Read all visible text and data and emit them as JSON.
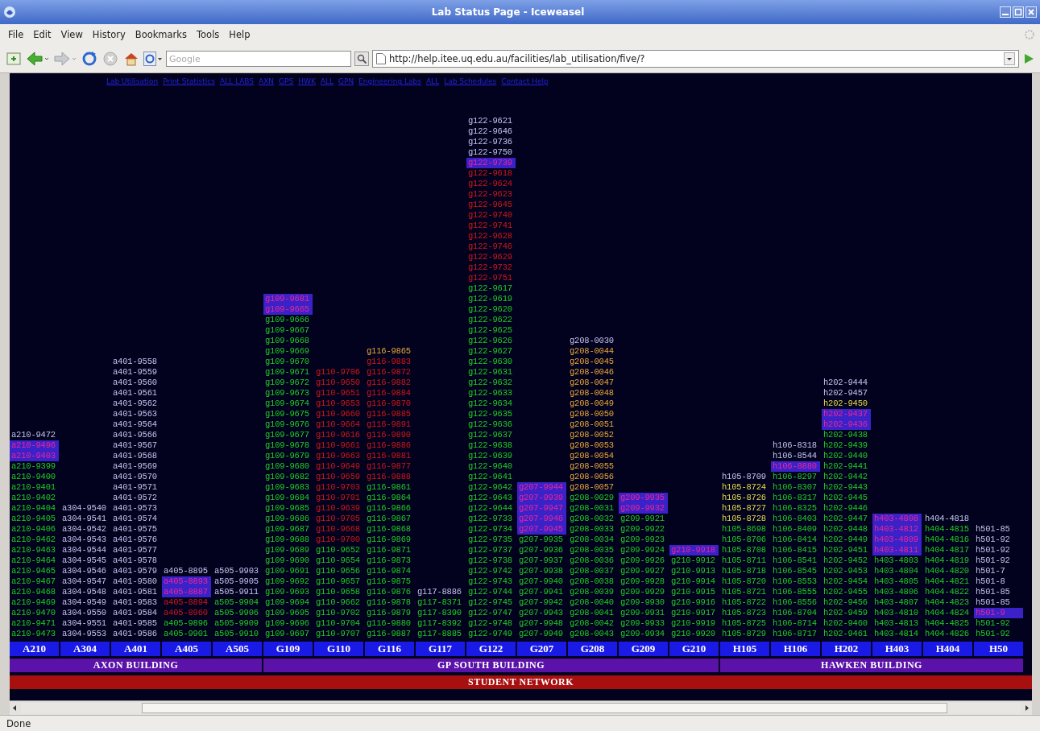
{
  "window": {
    "title": "Lab Status Page - Iceweasel"
  },
  "menu": [
    "File",
    "Edit",
    "View",
    "History",
    "Bookmarks",
    "Tools",
    "Help"
  ],
  "toolbar": {
    "search": {
      "placeholder": "Google"
    },
    "address": "http://help.itee.uq.edu.au/facilities/lab_utilisation/five/?"
  },
  "nav_links": [
    "Lab Utilisation",
    "Print Statistics",
    "ALL LABS",
    "AXN",
    "GPS",
    "HWK",
    "ALL",
    "GPN",
    "Engineering Labs",
    "ALL",
    "Lab Schedules",
    "Contact Help"
  ],
  "buildings": [
    {
      "label": "AXON BUILDING",
      "rooms": [
        {
          "label": "A210",
          "hosts": [
            {
              "name": "a210-9472",
              "kind": "free"
            },
            {
              "name": "a210-9496",
              "kind": "locked"
            },
            {
              "name": "a210-9403",
              "kind": "locked"
            },
            {
              "name": "a210-9399",
              "kind": "used"
            },
            {
              "name": "a210-9400",
              "kind": "used"
            },
            {
              "name": "a210-9401",
              "kind": "used"
            },
            {
              "name": "a210-9402",
              "kind": "used"
            },
            {
              "name": "a210-9404",
              "kind": "used"
            },
            {
              "name": "a210-9405",
              "kind": "used"
            },
            {
              "name": "a210-9406",
              "kind": "used"
            },
            {
              "name": "a210-9462",
              "kind": "used"
            },
            {
              "name": "a210-9463",
              "kind": "used"
            },
            {
              "name": "a210-9464",
              "kind": "used"
            },
            {
              "name": "a210-9465",
              "kind": "used"
            },
            {
              "name": "a210-9467",
              "kind": "used"
            },
            {
              "name": "a210-9468",
              "kind": "used"
            },
            {
              "name": "a210-9469",
              "kind": "used"
            },
            {
              "name": "a210-9470",
              "kind": "used"
            },
            {
              "name": "a210-9471",
              "kind": "used"
            },
            {
              "name": "a210-9473",
              "kind": "used"
            }
          ]
        },
        {
          "label": "A304",
          "hosts": [
            {
              "name": "a304-9540",
              "kind": "free"
            },
            {
              "name": "a304-9541",
              "kind": "free"
            },
            {
              "name": "a304-9542",
              "kind": "free"
            },
            {
              "name": "a304-9543",
              "kind": "free"
            },
            {
              "name": "a304-9544",
              "kind": "free"
            },
            {
              "name": "a304-9545",
              "kind": "free"
            },
            {
              "name": "a304-9546",
              "kind": "free"
            },
            {
              "name": "a304-9547",
              "kind": "free"
            },
            {
              "name": "a304-9548",
              "kind": "free"
            },
            {
              "name": "a304-9549",
              "kind": "free"
            },
            {
              "name": "a304-9550",
              "kind": "free"
            },
            {
              "name": "a304-9551",
              "kind": "free"
            },
            {
              "name": "a304-9553",
              "kind": "free"
            }
          ]
        },
        {
          "label": "A401",
          "hosts": [
            {
              "name": "a401-9558",
              "kind": "free"
            },
            {
              "name": "a401-9559",
              "kind": "free"
            },
            {
              "name": "a401-9560",
              "kind": "free"
            },
            {
              "name": "a401-9561",
              "kind": "free"
            },
            {
              "name": "a401-9562",
              "kind": "free"
            },
            {
              "name": "a401-9563",
              "kind": "free"
            },
            {
              "name": "a401-9564",
              "kind": "free"
            },
            {
              "name": "a401-9566",
              "kind": "free"
            },
            {
              "name": "a401-9567",
              "kind": "free"
            },
            {
              "name": "a401-9568",
              "kind": "free"
            },
            {
              "name": "a401-9569",
              "kind": "free"
            },
            {
              "name": "a401-9570",
              "kind": "free"
            },
            {
              "name": "a401-9571",
              "kind": "free"
            },
            {
              "name": "a401-9572",
              "kind": "free"
            },
            {
              "name": "a401-9573",
              "kind": "free"
            },
            {
              "name": "a401-9574",
              "kind": "free"
            },
            {
              "name": "a401-9575",
              "kind": "free"
            },
            {
              "name": "a401-9576",
              "kind": "free"
            },
            {
              "name": "a401-9577",
              "kind": "free"
            },
            {
              "name": "a401-9578",
              "kind": "free"
            },
            {
              "name": "a401-9579",
              "kind": "free"
            },
            {
              "name": "a401-9580",
              "kind": "free"
            },
            {
              "name": "a401-9581",
              "kind": "free"
            },
            {
              "name": "a401-9583",
              "kind": "free"
            },
            {
              "name": "a401-9584",
              "kind": "free"
            },
            {
              "name": "a401-9585",
              "kind": "free"
            },
            {
              "name": "a401-9586",
              "kind": "free"
            }
          ]
        },
        {
          "label": "A405",
          "hosts": [
            {
              "name": "a405-8895",
              "kind": "free"
            },
            {
              "name": "a405-8893",
              "kind": "locked"
            },
            {
              "name": "a405-8887",
              "kind": "locked"
            },
            {
              "name": "a405-8894",
              "kind": "down"
            },
            {
              "name": "a405-8960",
              "kind": "down"
            },
            {
              "name": "a405-9896",
              "kind": "used"
            },
            {
              "name": "a405-9901",
              "kind": "used"
            }
          ]
        },
        {
          "label": "A505",
          "hosts": [
            {
              "name": "a505-9903",
              "kind": "free"
            },
            {
              "name": "a505-9905",
              "kind": "free"
            },
            {
              "name": "a505-9911",
              "kind": "free"
            },
            {
              "name": "a505-9904",
              "kind": "used"
            },
            {
              "name": "a505-9906",
              "kind": "used"
            },
            {
              "name": "a505-9909",
              "kind": "used"
            },
            {
              "name": "a505-9910",
              "kind": "used"
            }
          ]
        }
      ]
    },
    {
      "label": "GP SOUTH BUILDING",
      "rooms": [
        {
          "label": "G109",
          "hosts": [
            {
              "name": "g109-9681",
              "kind": "locked"
            },
            {
              "name": "g109-9665",
              "kind": "locked"
            },
            {
              "name": "g109-9666",
              "kind": "used"
            },
            {
              "name": "g109-9667",
              "kind": "used"
            },
            {
              "name": "g109-9668",
              "kind": "used"
            },
            {
              "name": "g109-9669",
              "kind": "used"
            },
            {
              "name": "g109-9670",
              "kind": "used"
            },
            {
              "name": "g109-9671",
              "kind": "used"
            },
            {
              "name": "g109-9672",
              "kind": "used"
            },
            {
              "name": "g109-9673",
              "kind": "used"
            },
            {
              "name": "g109-9674",
              "kind": "used"
            },
            {
              "name": "g109-9675",
              "kind": "used"
            },
            {
              "name": "g109-9676",
              "kind": "used"
            },
            {
              "name": "g109-9677",
              "kind": "used"
            },
            {
              "name": "g109-9678",
              "kind": "used"
            },
            {
              "name": "g109-9679",
              "kind": "used"
            },
            {
              "name": "g109-9680",
              "kind": "used"
            },
            {
              "name": "g109-9682",
              "kind": "used"
            },
            {
              "name": "g109-9683",
              "kind": "used"
            },
            {
              "name": "g109-9684",
              "kind": "used"
            },
            {
              "name": "g109-9685",
              "kind": "used"
            },
            {
              "name": "g109-9686",
              "kind": "used"
            },
            {
              "name": "g109-9687",
              "kind": "used"
            },
            {
              "name": "g109-9688",
              "kind": "used"
            },
            {
              "name": "g109-9689",
              "kind": "used"
            },
            {
              "name": "g109-9690",
              "kind": "used"
            },
            {
              "name": "g109-9691",
              "kind": "used"
            },
            {
              "name": "g109-9692",
              "kind": "used"
            },
            {
              "name": "g109-9693",
              "kind": "used"
            },
            {
              "name": "g109-9694",
              "kind": "used"
            },
            {
              "name": "g109-9695",
              "kind": "used"
            },
            {
              "name": "g109-9696",
              "kind": "used"
            },
            {
              "name": "g109-9697",
              "kind": "used"
            }
          ]
        },
        {
          "label": "G110",
          "hosts": [
            {
              "name": "g110-9706",
              "kind": "down"
            },
            {
              "name": "g110-9650",
              "kind": "down"
            },
            {
              "name": "g110-9651",
              "kind": "down"
            },
            {
              "name": "g110-9653",
              "kind": "down"
            },
            {
              "name": "g110-9660",
              "kind": "down"
            },
            {
              "name": "g110-9664",
              "kind": "down"
            },
            {
              "name": "g110-9616",
              "kind": "down"
            },
            {
              "name": "g110-9661",
              "kind": "down"
            },
            {
              "name": "g110-9663",
              "kind": "down"
            },
            {
              "name": "g110-9649",
              "kind": "down"
            },
            {
              "name": "g110-9659",
              "kind": "down"
            },
            {
              "name": "g110-9703",
              "kind": "down"
            },
            {
              "name": "g110-9701",
              "kind": "down"
            },
            {
              "name": "g110-9639",
              "kind": "down"
            },
            {
              "name": "g110-9705",
              "kind": "down"
            },
            {
              "name": "g110-9668",
              "kind": "down"
            },
            {
              "name": "g110-9700",
              "kind": "down"
            },
            {
              "name": "g110-9652",
              "kind": "used"
            },
            {
              "name": "g110-9654",
              "kind": "used"
            },
            {
              "name": "g110-9656",
              "kind": "used"
            },
            {
              "name": "g110-9657",
              "kind": "used"
            },
            {
              "name": "g110-9658",
              "kind": "used"
            },
            {
              "name": "g110-9662",
              "kind": "used"
            },
            {
              "name": "g110-9702",
              "kind": "used"
            },
            {
              "name": "g110-9704",
              "kind": "used"
            },
            {
              "name": "g110-9707",
              "kind": "used"
            }
          ]
        },
        {
          "label": "G116",
          "hosts": [
            {
              "name": "g116-9865",
              "kind": "booked"
            },
            {
              "name": "g116-9883",
              "kind": "down"
            },
            {
              "name": "g116-9872",
              "kind": "down"
            },
            {
              "name": "g116-9882",
              "kind": "down"
            },
            {
              "name": "g116-9884",
              "kind": "down"
            },
            {
              "name": "g116-9870",
              "kind": "down"
            },
            {
              "name": "g116-9885",
              "kind": "down"
            },
            {
              "name": "g116-9891",
              "kind": "down"
            },
            {
              "name": "g116-9890",
              "kind": "down"
            },
            {
              "name": "g116-9886",
              "kind": "down"
            },
            {
              "name": "g116-9881",
              "kind": "down"
            },
            {
              "name": "g116-9877",
              "kind": "down"
            },
            {
              "name": "g116-9888",
              "kind": "down"
            },
            {
              "name": "g116-9861",
              "kind": "used"
            },
            {
              "name": "g116-9864",
              "kind": "used"
            },
            {
              "name": "g116-9866",
              "kind": "used"
            },
            {
              "name": "g116-9867",
              "kind": "used"
            },
            {
              "name": "g116-9868",
              "kind": "used"
            },
            {
              "name": "g116-9869",
              "kind": "used"
            },
            {
              "name": "g116-9871",
              "kind": "used"
            },
            {
              "name": "g116-9873",
              "kind": "used"
            },
            {
              "name": "g116-9874",
              "kind": "used"
            },
            {
              "name": "g116-9875",
              "kind": "used"
            },
            {
              "name": "g116-9876",
              "kind": "used"
            },
            {
              "name": "g116-9878",
              "kind": "used"
            },
            {
              "name": "g116-9879",
              "kind": "used"
            },
            {
              "name": "g116-9880",
              "kind": "used"
            },
            {
              "name": "g116-9887",
              "kind": "used"
            }
          ]
        },
        {
          "label": "G117",
          "hosts": [
            {
              "name": "g117-8886",
              "kind": "free"
            },
            {
              "name": "g117-8371",
              "kind": "used"
            },
            {
              "name": "g117-8390",
              "kind": "used"
            },
            {
              "name": "g117-8392",
              "kind": "used"
            },
            {
              "name": "g117-8885",
              "kind": "used"
            }
          ]
        },
        {
          "label": "G122",
          "hosts": [
            {
              "name": "g122-9621",
              "kind": "free"
            },
            {
              "name": "g122-9646",
              "kind": "free"
            },
            {
              "name": "g122-9736",
              "kind": "free"
            },
            {
              "name": "g122-9750",
              "kind": "free"
            },
            {
              "name": "g122-9739",
              "kind": "locked"
            },
            {
              "name": "g122-9618",
              "kind": "down"
            },
            {
              "name": "g122-9624",
              "kind": "down"
            },
            {
              "name": "g122-9623",
              "kind": "down"
            },
            {
              "name": "g122-9645",
              "kind": "down"
            },
            {
              "name": "g122-9740",
              "kind": "down"
            },
            {
              "name": "g122-9741",
              "kind": "down"
            },
            {
              "name": "g122-9628",
              "kind": "down"
            },
            {
              "name": "g122-9746",
              "kind": "down"
            },
            {
              "name": "g122-9629",
              "kind": "down"
            },
            {
              "name": "g122-9732",
              "kind": "down"
            },
            {
              "name": "g122-9751",
              "kind": "down"
            },
            {
              "name": "g122-9617",
              "kind": "used"
            },
            {
              "name": "g122-9619",
              "kind": "used"
            },
            {
              "name": "g122-9620",
              "kind": "used"
            },
            {
              "name": "g122-9622",
              "kind": "used"
            },
            {
              "name": "g122-9625",
              "kind": "used"
            },
            {
              "name": "g122-9626",
              "kind": "used"
            },
            {
              "name": "g122-9627",
              "kind": "used"
            },
            {
              "name": "g122-9630",
              "kind": "used"
            },
            {
              "name": "g122-9631",
              "kind": "used"
            },
            {
              "name": "g122-9632",
              "kind": "used"
            },
            {
              "name": "g122-9633",
              "kind": "used"
            },
            {
              "name": "g122-9634",
              "kind": "used"
            },
            {
              "name": "g122-9635",
              "kind": "used"
            },
            {
              "name": "g122-9636",
              "kind": "used"
            },
            {
              "name": "g122-9637",
              "kind": "used"
            },
            {
              "name": "g122-9638",
              "kind": "used"
            },
            {
              "name": "g122-9639",
              "kind": "used"
            },
            {
              "name": "g122-9640",
              "kind": "used"
            },
            {
              "name": "g122-9641",
              "kind": "used"
            },
            {
              "name": "g122-9642",
              "kind": "used"
            },
            {
              "name": "g122-9643",
              "kind": "used"
            },
            {
              "name": "g122-9644",
              "kind": "used"
            },
            {
              "name": "g122-9733",
              "kind": "used"
            },
            {
              "name": "g122-9734",
              "kind": "used"
            },
            {
              "name": "g122-9735",
              "kind": "used"
            },
            {
              "name": "g122-9737",
              "kind": "used"
            },
            {
              "name": "g122-9738",
              "kind": "used"
            },
            {
              "name": "g122-9742",
              "kind": "used"
            },
            {
              "name": "g122-9743",
              "kind": "used"
            },
            {
              "name": "g122-9744",
              "kind": "used"
            },
            {
              "name": "g122-9745",
              "kind": "used"
            },
            {
              "name": "g122-9747",
              "kind": "used"
            },
            {
              "name": "g122-9748",
              "kind": "used"
            },
            {
              "name": "g122-9749",
              "kind": "used"
            }
          ]
        },
        {
          "label": "G207",
          "hosts": [
            {
              "name": "g207-9944",
              "kind": "locked"
            },
            {
              "name": "g207-9939",
              "kind": "locked"
            },
            {
              "name": "g207-9947",
              "kind": "locked"
            },
            {
              "name": "g207-9946",
              "kind": "locked"
            },
            {
              "name": "g207-9945",
              "kind": "locked"
            },
            {
              "name": "g207-9935",
              "kind": "used"
            },
            {
              "name": "g207-9936",
              "kind": "used"
            },
            {
              "name": "g207-9937",
              "kind": "used"
            },
            {
              "name": "g207-9938",
              "kind": "used"
            },
            {
              "name": "g207-9940",
              "kind": "used"
            },
            {
              "name": "g207-9941",
              "kind": "used"
            },
            {
              "name": "g207-9942",
              "kind": "used"
            },
            {
              "name": "g207-9943",
              "kind": "used"
            },
            {
              "name": "g207-9948",
              "kind": "used"
            },
            {
              "name": "g207-9949",
              "kind": "used"
            }
          ]
        },
        {
          "label": "G208",
          "hosts": [
            {
              "name": "g208-0030",
              "kind": "free"
            },
            {
              "name": "g208-0044",
              "kind": "booked"
            },
            {
              "name": "g208-0045",
              "kind": "booked"
            },
            {
              "name": "g208-0046",
              "kind": "booked"
            },
            {
              "name": "g208-0047",
              "kind": "booked"
            },
            {
              "name": "g208-0048",
              "kind": "booked"
            },
            {
              "name": "g208-0049",
              "kind": "booked"
            },
            {
              "name": "g208-0050",
              "kind": "booked"
            },
            {
              "name": "g208-0051",
              "kind": "booked"
            },
            {
              "name": "g208-0052",
              "kind": "booked"
            },
            {
              "name": "g208-0053",
              "kind": "booked"
            },
            {
              "name": "g208-0054",
              "kind": "booked"
            },
            {
              "name": "g208-0055",
              "kind": "booked"
            },
            {
              "name": "g208-0056",
              "kind": "booked"
            },
            {
              "name": "g208-0057",
              "kind": "booked"
            },
            {
              "name": "g208-0029",
              "kind": "used"
            },
            {
              "name": "g208-0031",
              "kind": "used"
            },
            {
              "name": "g208-0032",
              "kind": "used"
            },
            {
              "name": "g208-0033",
              "kind": "used"
            },
            {
              "name": "g208-0034",
              "kind": "used"
            },
            {
              "name": "g208-0035",
              "kind": "used"
            },
            {
              "name": "g208-0036",
              "kind": "used"
            },
            {
              "name": "g208-0037",
              "kind": "used"
            },
            {
              "name": "g208-0038",
              "kind": "used"
            },
            {
              "name": "g208-0039",
              "kind": "used"
            },
            {
              "name": "g208-0040",
              "kind": "used"
            },
            {
              "name": "g208-0041",
              "kind": "used"
            },
            {
              "name": "g208-0042",
              "kind": "used"
            },
            {
              "name": "g208-0043",
              "kind": "used"
            }
          ]
        },
        {
          "label": "G209",
          "hosts": [
            {
              "name": "g209-9935",
              "kind": "locked"
            },
            {
              "name": "g209-9932",
              "kind": "locked"
            },
            {
              "name": "g209-9921",
              "kind": "used"
            },
            {
              "name": "g209-9922",
              "kind": "used"
            },
            {
              "name": "g209-9923",
              "kind": "used"
            },
            {
              "name": "g209-9924",
              "kind": "used"
            },
            {
              "name": "g209-9926",
              "kind": "used"
            },
            {
              "name": "g209-9927",
              "kind": "used"
            },
            {
              "name": "g209-9928",
              "kind": "used"
            },
            {
              "name": "g209-9929",
              "kind": "used"
            },
            {
              "name": "g209-9930",
              "kind": "used"
            },
            {
              "name": "g209-9931",
              "kind": "used"
            },
            {
              "name": "g209-9933",
              "kind": "used"
            },
            {
              "name": "g209-9934",
              "kind": "used"
            }
          ]
        },
        {
          "label": "G210",
          "hosts": [
            {
              "name": "g210-9918",
              "kind": "locked"
            },
            {
              "name": "g210-9912",
              "kind": "used"
            },
            {
              "name": "g210-9913",
              "kind": "used"
            },
            {
              "name": "g210-9914",
              "kind": "used"
            },
            {
              "name": "g210-9915",
              "kind": "used"
            },
            {
              "name": "g210-9916",
              "kind": "used"
            },
            {
              "name": "g210-9917",
              "kind": "used"
            },
            {
              "name": "g210-9919",
              "kind": "used"
            },
            {
              "name": "g210-9920",
              "kind": "used"
            }
          ]
        }
      ]
    },
    {
      "label": "HAWKEN BUILDING",
      "rooms": [
        {
          "label": "H105",
          "hosts": [
            {
              "name": "h105-8709",
              "kind": "free"
            },
            {
              "name": "h105-8724",
              "kind": "reserved"
            },
            {
              "name": "h105-8726",
              "kind": "reserved"
            },
            {
              "name": "h105-8727",
              "kind": "reserved"
            },
            {
              "name": "h105-8728",
              "kind": "reserved"
            },
            {
              "name": "h105-8698",
              "kind": "used"
            },
            {
              "name": "h105-8706",
              "kind": "used"
            },
            {
              "name": "h105-8708",
              "kind": "used"
            },
            {
              "name": "h105-8711",
              "kind": "used"
            },
            {
              "name": "h105-8718",
              "kind": "used"
            },
            {
              "name": "h105-8720",
              "kind": "used"
            },
            {
              "name": "h105-8721",
              "kind": "used"
            },
            {
              "name": "h105-8722",
              "kind": "used"
            },
            {
              "name": "h105-8723",
              "kind": "used"
            },
            {
              "name": "h105-8725",
              "kind": "used"
            },
            {
              "name": "h105-8729",
              "kind": "used"
            }
          ]
        },
        {
          "label": "H106",
          "hosts": [
            {
              "name": "h106-8318",
              "kind": "free"
            },
            {
              "name": "h106-8544",
              "kind": "free"
            },
            {
              "name": "h106-8880",
              "kind": "locked"
            },
            {
              "name": "h106-8297",
              "kind": "used"
            },
            {
              "name": "h106-8307",
              "kind": "used"
            },
            {
              "name": "h106-8317",
              "kind": "used"
            },
            {
              "name": "h106-8325",
              "kind": "used"
            },
            {
              "name": "h106-8403",
              "kind": "used"
            },
            {
              "name": "h106-8409",
              "kind": "used"
            },
            {
              "name": "h106-8414",
              "kind": "used"
            },
            {
              "name": "h106-8415",
              "kind": "used"
            },
            {
              "name": "h106-8541",
              "kind": "used"
            },
            {
              "name": "h106-8545",
              "kind": "used"
            },
            {
              "name": "h106-8553",
              "kind": "used"
            },
            {
              "name": "h106-8555",
              "kind": "used"
            },
            {
              "name": "h106-8556",
              "kind": "used"
            },
            {
              "name": "h106-8704",
              "kind": "used"
            },
            {
              "name": "h106-8714",
              "kind": "used"
            },
            {
              "name": "h106-8717",
              "kind": "used"
            }
          ]
        },
        {
          "label": "H202",
          "hosts": [
            {
              "name": "h202-9444",
              "kind": "free"
            },
            {
              "name": "h202-9457",
              "kind": "free"
            },
            {
              "name": "h202-9450",
              "kind": "reserved"
            },
            {
              "name": "h202-9437",
              "kind": "locked"
            },
            {
              "name": "h202-9436",
              "kind": "locked"
            },
            {
              "name": "h202-9438",
              "kind": "used"
            },
            {
              "name": "h202-9439",
              "kind": "used"
            },
            {
              "name": "h202-9440",
              "kind": "used"
            },
            {
              "name": "h202-9441",
              "kind": "used"
            },
            {
              "name": "h202-9442",
              "kind": "used"
            },
            {
              "name": "h202-9443",
              "kind": "used"
            },
            {
              "name": "h202-9445",
              "kind": "used"
            },
            {
              "name": "h202-9446",
              "kind": "used"
            },
            {
              "name": "h202-9447",
              "kind": "used"
            },
            {
              "name": "h202-9448",
              "kind": "used"
            },
            {
              "name": "h202-9449",
              "kind": "used"
            },
            {
              "name": "h202-9451",
              "kind": "used"
            },
            {
              "name": "h202-9452",
              "kind": "used"
            },
            {
              "name": "h202-9453",
              "kind": "used"
            },
            {
              "name": "h202-9454",
              "kind": "used"
            },
            {
              "name": "h202-9455",
              "kind": "used"
            },
            {
              "name": "h202-9456",
              "kind": "used"
            },
            {
              "name": "h202-9459",
              "kind": "used"
            },
            {
              "name": "h202-9460",
              "kind": "used"
            },
            {
              "name": "h202-9461",
              "kind": "used"
            }
          ]
        },
        {
          "label": "H403",
          "hosts": [
            {
              "name": "h403-4808",
              "kind": "locked"
            },
            {
              "name": "h403-4812",
              "kind": "locked"
            },
            {
              "name": "h403-4809",
              "kind": "locked"
            },
            {
              "name": "h403-4811",
              "kind": "locked"
            },
            {
              "name": "h403-4803",
              "kind": "used"
            },
            {
              "name": "h403-4804",
              "kind": "used"
            },
            {
              "name": "h403-4805",
              "kind": "used"
            },
            {
              "name": "h403-4806",
              "kind": "used"
            },
            {
              "name": "h403-4807",
              "kind": "used"
            },
            {
              "name": "h403-4810",
              "kind": "used"
            },
            {
              "name": "h403-4813",
              "kind": "used"
            },
            {
              "name": "h403-4814",
              "kind": "used"
            }
          ]
        },
        {
          "label": "H404",
          "hosts": [
            {
              "name": "h404-4818",
              "kind": "free"
            },
            {
              "name": "h404-4815",
              "kind": "used"
            },
            {
              "name": "h404-4816",
              "kind": "used"
            },
            {
              "name": "h404-4817",
              "kind": "used"
            },
            {
              "name": "h404-4819",
              "kind": "used"
            },
            {
              "name": "h404-4820",
              "kind": "used"
            },
            {
              "name": "h404-4821",
              "kind": "used"
            },
            {
              "name": "h404-4822",
              "kind": "used"
            },
            {
              "name": "h404-4823",
              "kind": "used"
            },
            {
              "name": "h404-4824",
              "kind": "used"
            },
            {
              "name": "h404-4825",
              "kind": "used"
            },
            {
              "name": "h404-4826",
              "kind": "used"
            }
          ]
        },
        {
          "label": "H50",
          "hosts": [
            {
              "name": "h501-85",
              "kind": "free"
            },
            {
              "name": "h501-92",
              "kind": "free"
            },
            {
              "name": "h501-92",
              "kind": "free"
            },
            {
              "name": "h501-92",
              "kind": "free"
            },
            {
              "name": "h501-7",
              "kind": "free"
            },
            {
              "name": "h501-8",
              "kind": "free"
            },
            {
              "name": "h501-85",
              "kind": "free"
            },
            {
              "name": "h501-85",
              "kind": "free"
            },
            {
              "name": "h501-9",
              "kind": "locked"
            },
            {
              "name": "h501-92",
              "kind": "used"
            },
            {
              "name": "h501-92",
              "kind": "used"
            }
          ]
        }
      ]
    }
  ],
  "network": "STUDENT NETWORK",
  "status_bar": "Done"
}
